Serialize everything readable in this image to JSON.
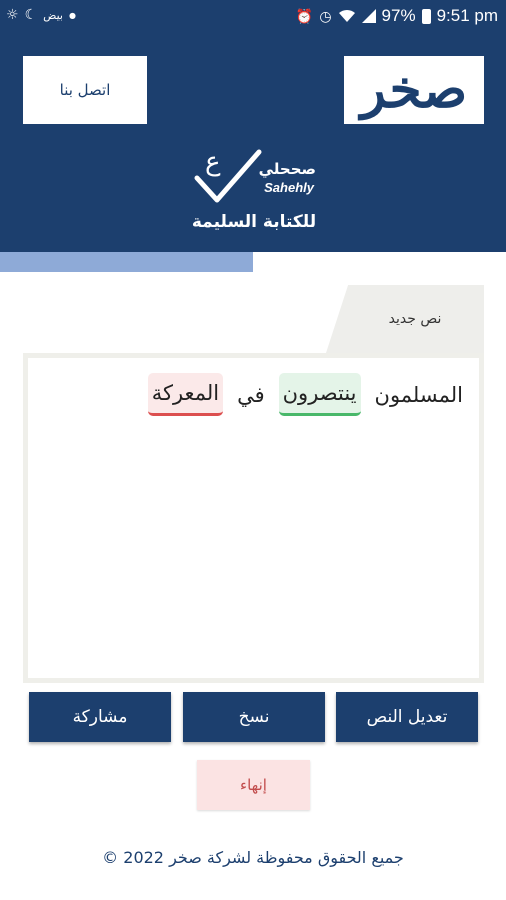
{
  "status_bar": {
    "time": "9:51 pm",
    "battery": "97%",
    "left_text": "بيض",
    "icons": [
      "weather-sun-icon",
      "crescent-icon",
      "dot-icon",
      "alarm-icon",
      "clock-icon",
      "wifi-icon",
      "signal-icon",
      "battery-icon"
    ]
  },
  "header": {
    "logo_text": "صخر",
    "contact_label": "اتصل بنا",
    "brand_ar": "صححلي",
    "brand_en": "Sahehly",
    "tagline": "للكتابة السليمة",
    "progress_fraction": 0.5
  },
  "tab": {
    "label": "نص جديد"
  },
  "editor": {
    "words": [
      {
        "text": "المسلمون",
        "status": "normal"
      },
      {
        "text": "ينتصرون",
        "status": "correct"
      },
      {
        "text": "في",
        "status": "normal"
      },
      {
        "text": "المعركة",
        "status": "wrong"
      }
    ]
  },
  "actions": {
    "edit_label": "تعديل النص",
    "copy_label": "نسخ",
    "share_label": "مشاركة",
    "finish_label": "إنهاء"
  },
  "footer": {
    "text": "© جميع الحقوق محفوظة لشركة صخر 2022"
  },
  "colors": {
    "primary": "#1c3f6e",
    "progress": "#8eaad7",
    "correct_bg": "#e4f4e8",
    "correct_line": "#49b86a",
    "wrong_bg": "#fbe9e9",
    "wrong_line": "#dc4f4f",
    "finish_bg": "#fbe3e3",
    "finish_text": "#c24c4c"
  }
}
